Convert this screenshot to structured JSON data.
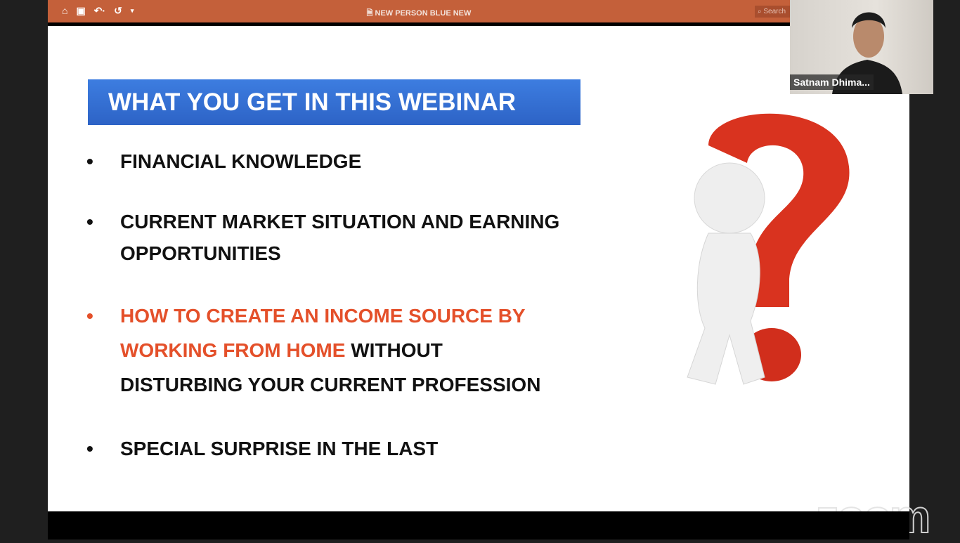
{
  "toolbar": {
    "icons": [
      "home-icon",
      "save-icon",
      "undo-icon",
      "redo-icon",
      "customize-icon"
    ],
    "document_title": "NEW PERSON BLUE NEW",
    "search_placeholder": "Search"
  },
  "slide": {
    "heading": "WHAT YOU GET IN THIS WEBINAR",
    "bullets": [
      {
        "lines": [
          "FINANCIAL KNOWLEDGE"
        ]
      },
      {
        "lines": [
          "CURRENT MARKET SITUATION AND EARNING",
          "OPPORTUNITIES"
        ]
      },
      {
        "red_line1": "HOW TO CREATE AN INCOME SOURCE BY",
        "red_line2": "WORKING FROM HOME",
        "black_line2": " WITHOUT",
        "line3": "DISTURBING YOUR CURRENT PROFESSION"
      },
      {
        "lines": [
          "SPECIAL SURPRISE IN THE LAST"
        ]
      }
    ],
    "bullet_char": "•"
  },
  "video": {
    "participant_name": "Satnam Dhima..."
  },
  "watermark": "zoom",
  "colors": {
    "toolbar": "#c4603a",
    "heading_bg": "#3470d4",
    "highlight": "#e4502a",
    "question_mark": "#d9331f"
  }
}
